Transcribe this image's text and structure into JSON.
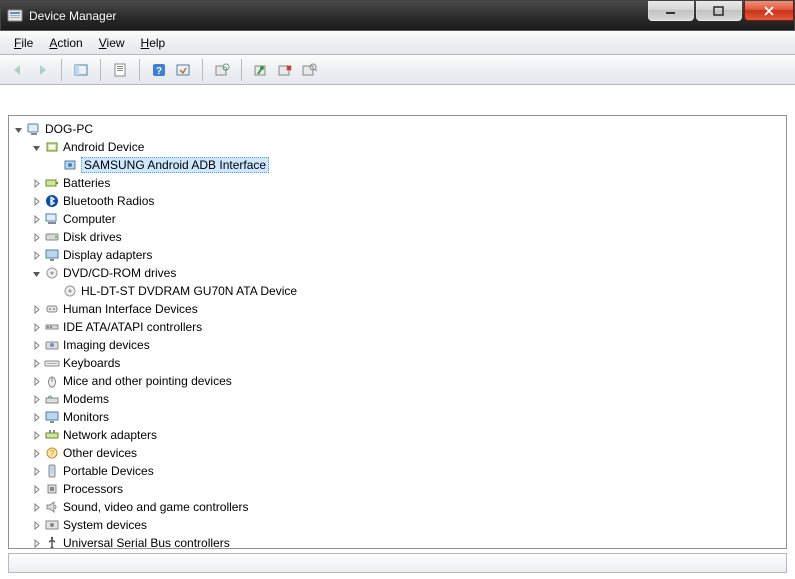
{
  "window": {
    "title": "Device Manager"
  },
  "menu": {
    "file": "File",
    "action": "Action",
    "view": "View",
    "help": "Help"
  },
  "tree": {
    "root": "DOG-PC",
    "nodes": [
      {
        "label": "Android Device",
        "expanded": true,
        "icon": "device-generic",
        "children": [
          {
            "label": "SAMSUNG Android ADB Interface",
            "icon": "device-adb",
            "selected": true
          }
        ]
      },
      {
        "label": "Batteries",
        "icon": "battery"
      },
      {
        "label": "Bluetooth Radios",
        "icon": "bluetooth"
      },
      {
        "label": "Computer",
        "icon": "computer"
      },
      {
        "label": "Disk drives",
        "icon": "disk"
      },
      {
        "label": "Display adapters",
        "icon": "display"
      },
      {
        "label": "DVD/CD-ROM drives",
        "expanded": true,
        "icon": "optical",
        "children": [
          {
            "label": "HL-DT-ST DVDRAM GU70N ATA Device",
            "icon": "optical"
          }
        ]
      },
      {
        "label": "Human Interface Devices",
        "icon": "hid"
      },
      {
        "label": "IDE ATA/ATAPI controllers",
        "icon": "ide"
      },
      {
        "label": "Imaging devices",
        "icon": "imaging"
      },
      {
        "label": "Keyboards",
        "icon": "keyboard"
      },
      {
        "label": "Mice and other pointing devices",
        "icon": "mouse"
      },
      {
        "label": "Modems",
        "icon": "modem"
      },
      {
        "label": "Monitors",
        "icon": "monitor"
      },
      {
        "label": "Network adapters",
        "icon": "network"
      },
      {
        "label": "Other devices",
        "icon": "other"
      },
      {
        "label": "Portable Devices",
        "icon": "portable"
      },
      {
        "label": "Processors",
        "icon": "cpu"
      },
      {
        "label": "Sound, video and game controllers",
        "icon": "sound"
      },
      {
        "label": "System devices",
        "icon": "system"
      },
      {
        "label": "Universal Serial Bus controllers",
        "icon": "usb"
      }
    ]
  }
}
